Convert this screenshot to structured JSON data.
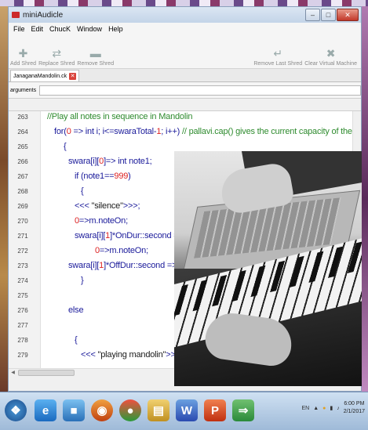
{
  "window": {
    "title": "miniAudicle"
  },
  "menu": [
    "File",
    "Edit",
    "ChucK",
    "Window",
    "Help"
  ],
  "toolbar": {
    "add_shred": "Add Shred",
    "replace_shred": "Replace Shred",
    "remove_shred": "Remove Shred",
    "remove_last_shred": "Remove Last Shred",
    "clear_vm": "Clear Virtual Machine"
  },
  "tab": {
    "name": "JanaganaMandolin.ck"
  },
  "arguments": {
    "label": "arguments",
    "value": ""
  },
  "editor": {
    "lines": [
      {
        "n": "263"
      },
      {
        "n": "264"
      },
      {
        "n": "265"
      },
      {
        "n": "266"
      },
      {
        "n": "267"
      },
      {
        "n": "268"
      },
      {
        "n": "269"
      },
      {
        "n": "270"
      },
      {
        "n": "271"
      },
      {
        "n": "272"
      },
      {
        "n": "273"
      },
      {
        "n": "274"
      },
      {
        "n": "275"
      },
      {
        "n": "276"
      },
      {
        "n": "277"
      },
      {
        "n": "278"
      },
      {
        "n": "279"
      }
    ],
    "code": {
      "l263": "//Play all notes in sequence in Mandolin",
      "l264a": "for(",
      "l264b": "0",
      "l264c": " => int i; i<=swaraTotal-",
      "l264d": "1",
      "l264e": "; i++) ",
      "l264f": "// pallavi.cap() gives the current capacity of the array, i.e.total number of e",
      "l265": "{",
      "l266a": "swara[i][",
      "l266b": "0",
      "l266c": "]=> int note1;",
      "l267a": "if (note1==",
      "l267b": "999",
      "l267c": ")",
      "l268": "{",
      "l269a": "<<< ",
      "l269b": "\"silence\"",
      "l269c": ">>>;",
      "l270a": "0",
      "l270b": "=>m.noteOn;",
      "l271a": "swara[i][",
      "l271b": "1",
      "l271c": "]*OnDur::second => now;",
      "l272a": "0",
      "l272b": "=>m.noteOn;",
      "l273a": "swara[i][",
      "l273b": "1",
      "l273c": "]*OffDur::second => now;",
      "l274": "}",
      "l276": "else",
      "l278": "{",
      "l279a": "<<< ",
      "l279b": "\"playing mandolin\"",
      "l279c": ">>>;"
    }
  },
  "taskbar": {
    "lang": "EN",
    "time": "6:00 PM",
    "date": "2/1/2017"
  },
  "colors": {
    "keyword": "#1a1a9a",
    "comment": "#2e8b2e",
    "number": "#dd2222"
  }
}
